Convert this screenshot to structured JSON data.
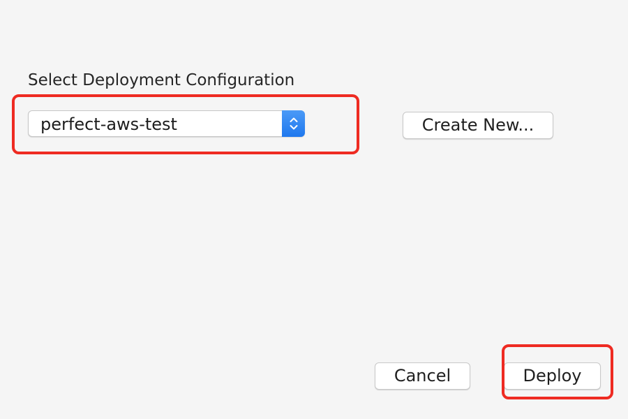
{
  "dialog": {
    "section_label": "Select Deployment Configuration",
    "configuration_select": {
      "value": "perfect-aws-test",
      "icon": "up-down-chevron-icon"
    },
    "create_new_label": "Create New...",
    "cancel_label": "Cancel",
    "deploy_label": "Deploy"
  },
  "annotations": {
    "highlight_color": "#ee2b22"
  },
  "colors": {
    "background": "#f5f5f5",
    "accent": "#1f78ee"
  }
}
